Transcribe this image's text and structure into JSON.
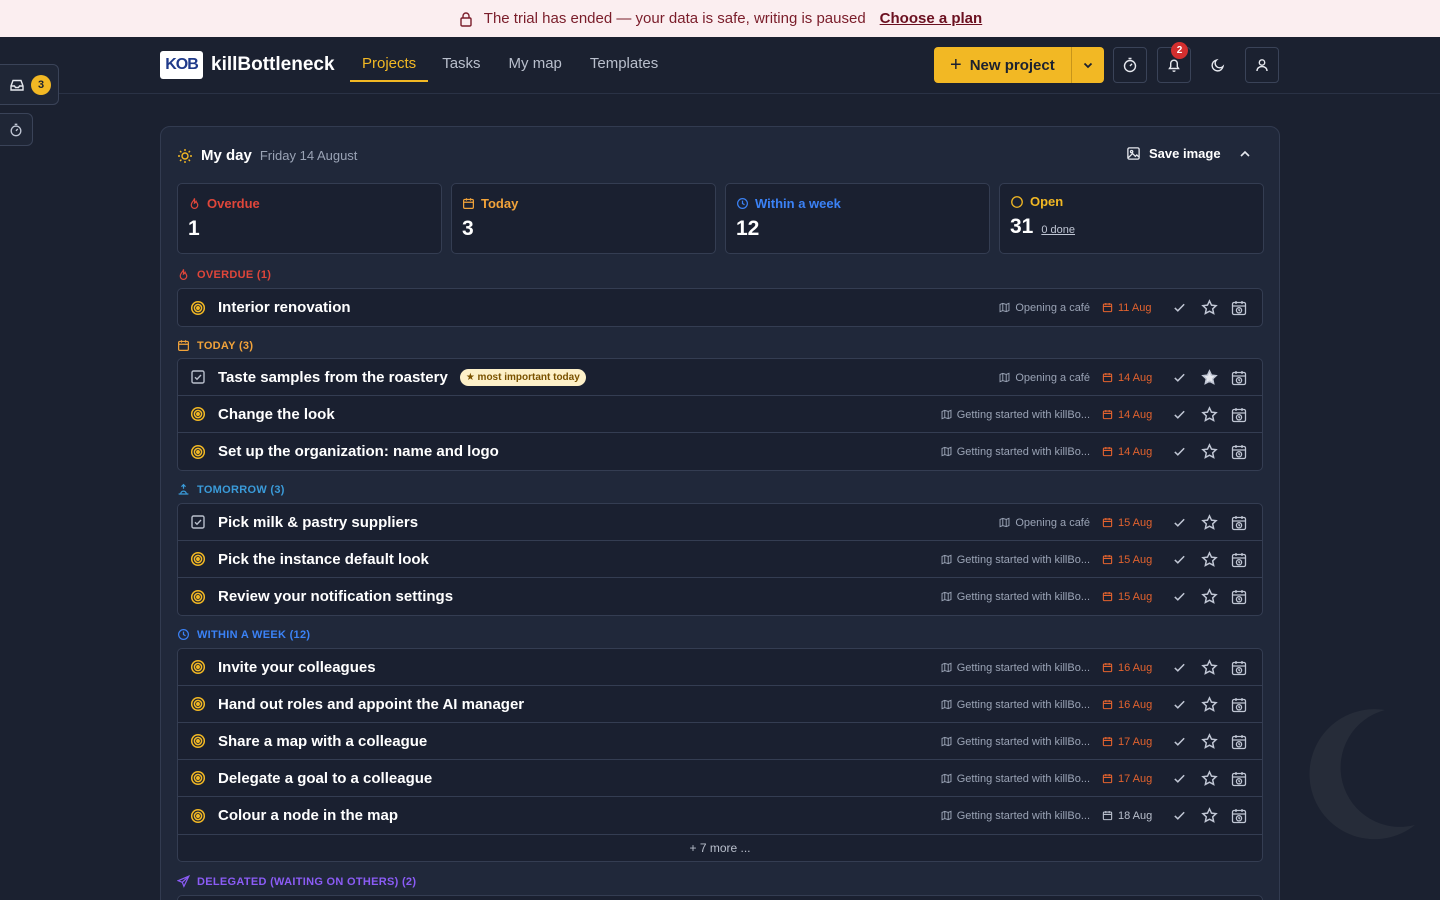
{
  "banner": {
    "message": "The trial has ended — your data is safe, writing is paused",
    "link": "Choose a plan"
  },
  "nav": {
    "brand": "killBottleneck",
    "logo_text": "KOB",
    "tabs": [
      {
        "label": "Projects",
        "active": true
      },
      {
        "label": "Tasks",
        "active": false
      },
      {
        "label": "My map",
        "active": false
      },
      {
        "label": "Templates",
        "active": false
      }
    ],
    "new_project": "New project",
    "notifications_count": "2"
  },
  "side": {
    "inbox_count": "3"
  },
  "myday": {
    "title": "My day",
    "date": "Friday 14 August",
    "save_image": "Save image",
    "stats": [
      {
        "label": "Overdue",
        "value": "1",
        "color": "#e0463a"
      },
      {
        "label": "Today",
        "value": "3",
        "color": "#f2a33a"
      },
      {
        "label": "Within a week",
        "value": "12",
        "color": "#3b82f6"
      },
      {
        "label": "Open",
        "value": "31",
        "done": "0 done",
        "color": "#f2b824"
      }
    ],
    "sections": {
      "overdue": "OVERDUE (1)",
      "today": "TODAY (3)",
      "tomorrow": "TOMORROW (3)",
      "week": "WITHIN A WEEK (12)",
      "delegated": "DELEGATED (WAITING ON OTHERS) (2)"
    },
    "overdue_tasks": [
      {
        "title": "Interior renovation",
        "project": "Opening a café",
        "due": "11 Aug",
        "type": "goal"
      }
    ],
    "today_tasks": [
      {
        "title": "Taste samples from the roastery",
        "badge": "★ most important today",
        "project": "Opening a café",
        "due": "14 Aug",
        "type": "task",
        "starred": true
      },
      {
        "title": "Change the look",
        "project": "Getting started with killBo...",
        "due": "14 Aug",
        "type": "goal"
      },
      {
        "title": "Set up the organization: name and logo",
        "project": "Getting started with killBo...",
        "due": "14 Aug",
        "type": "goal"
      }
    ],
    "tomorrow_tasks": [
      {
        "title": "Pick milk & pastry suppliers",
        "project": "Opening a café",
        "due": "15 Aug",
        "type": "task"
      },
      {
        "title": "Pick the instance default look",
        "project": "Getting started with killBo...",
        "due": "15 Aug",
        "type": "goal"
      },
      {
        "title": "Review your notification settings",
        "project": "Getting started with killBo...",
        "due": "15 Aug",
        "type": "goal"
      }
    ],
    "week_tasks": [
      {
        "title": "Invite your colleagues",
        "project": "Getting started with killBo...",
        "due": "16 Aug",
        "type": "goal"
      },
      {
        "title": "Hand out roles and appoint the AI manager",
        "project": "Getting started with killBo...",
        "due": "16 Aug",
        "type": "goal"
      },
      {
        "title": "Share a map with a colleague",
        "project": "Getting started with killBo...",
        "due": "17 Aug",
        "type": "goal"
      },
      {
        "title": "Delegate a goal to a colleague",
        "project": "Getting started with killBo...",
        "due": "17 Aug",
        "type": "goal"
      },
      {
        "title": "Colour a node in the map",
        "project": "Getting started with killBo...",
        "due": "18 Aug",
        "type": "goal",
        "due_neutral": true
      }
    ],
    "more": "+ 7 more ..."
  },
  "colors": {
    "accent": "#f2b824",
    "overdue": "#e0463a",
    "due": "#e2622e",
    "today": "#f2a33a",
    "tomorrow": "#3a9bd9",
    "week": "#3b82f6",
    "delegated": "#8b5cf6"
  }
}
